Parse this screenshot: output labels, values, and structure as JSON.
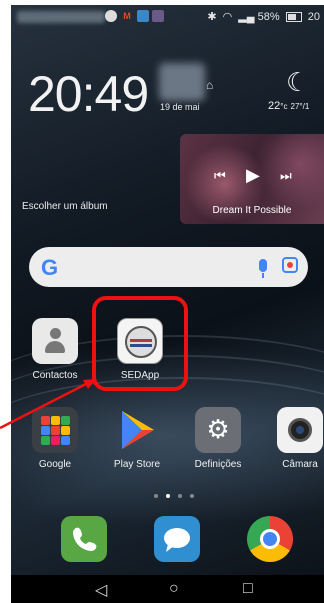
{
  "statusbar": {
    "notification_letter": "M",
    "battery": "58%",
    "time_clipped": "20"
  },
  "clock_widget": {
    "time": "20:49",
    "date": "19 de mai",
    "temperature": "22",
    "temp_unit": "°c",
    "temp_range": "27°/1"
  },
  "music_widget": {
    "choose_album_label": "Escolher um álbum",
    "song_title": "Dream It Possible"
  },
  "search": {
    "logo": "G"
  },
  "apps": {
    "contacts": "Contactos",
    "sedapp": "SEDApp",
    "google": "Google",
    "play_store": "Play Store",
    "settings": "Definições",
    "camera": "Câmara"
  },
  "page_indicator": {
    "pages": 4,
    "current": 2
  },
  "colors": {
    "highlight": "#ee1111",
    "google_blue": "#4285f4",
    "phone_green": "#58a744",
    "messages_blue": "#2f8fd0"
  },
  "icons": [
    "phone-icon",
    "messages-icon",
    "chrome-icon",
    "back-icon",
    "home-icon",
    "recents-icon"
  ]
}
